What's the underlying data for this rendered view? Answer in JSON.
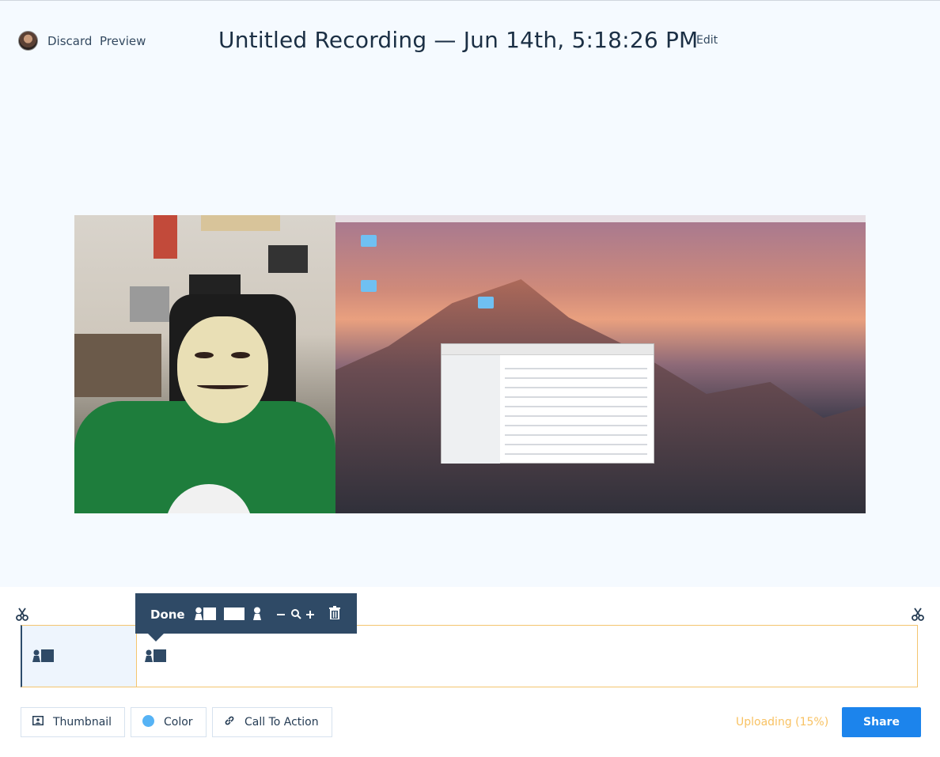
{
  "header": {
    "discard_label": "Discard",
    "preview_label": "Preview",
    "title": "Untitled Recording — Jun 14th, 5:18:26 PM",
    "edit_label": "Edit"
  },
  "editor_popover": {
    "done_label": "Done",
    "icons": [
      "layout-cam-screen-icon",
      "layout-screen-only-icon",
      "layout-cam-only-icon",
      "zoom-out-icon",
      "zoom-icon",
      "zoom-in-icon",
      "trash-icon"
    ]
  },
  "timeline": {
    "segments": [
      {
        "layout": "cam-screen",
        "selected": false
      },
      {
        "layout": "cam-screen",
        "selected": true
      }
    ],
    "accent_color": "#f4c56f"
  },
  "bottom_bar": {
    "thumbnail_label": "Thumbnail",
    "color_label": "Color",
    "color_value": "#56b3f5",
    "cta_label": "Call To Action",
    "upload_status": "Uploading (15%)",
    "upload_progress": 15,
    "share_label": "Share"
  },
  "colors": {
    "primary": "#1c84ec",
    "navy": "#2f4a66",
    "warning": "#f8c263",
    "stage_bg": "#f5faff"
  }
}
